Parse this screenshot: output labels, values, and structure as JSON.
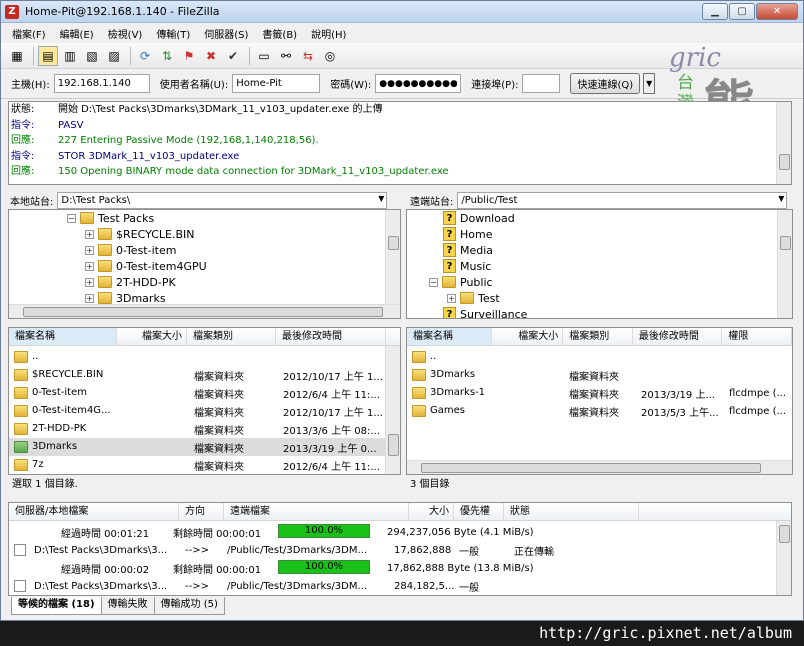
{
  "window": {
    "title": "Home-Pit@192.168.1.140 - FileZilla",
    "app_icon": "Z"
  },
  "menu": [
    "檔案(F)",
    "編輯(E)",
    "檢視(V)",
    "傳輸(T)",
    "伺服器(S)",
    "書籤(B)",
    "說明(H)"
  ],
  "quickconnect": {
    "host_label": "主機(H):",
    "host_value": "192.168.1.140",
    "user_label": "使用者名稱(U):",
    "user_value": "Home-Pit",
    "pass_label": "密碼(W):",
    "pass_value": "●●●●●●●●●●●●",
    "port_label": "連接埠(P):",
    "port_value": "",
    "connect_label": "快速連線(Q)"
  },
  "watermark": {
    "script": "gric",
    "taiwan": "台灣",
    "bear": "熊"
  },
  "log": [
    {
      "key": "狀態:",
      "text": "開始 D:\\Test Packs\\3Dmarks\\3DMark_11_v103_updater.exe 的上傳",
      "color": "#000000"
    },
    {
      "key": "指令:",
      "text": "PASV",
      "color": "#000080"
    },
    {
      "key": "回應:",
      "text": "227 Entering Passive Mode (192,168,1,140,218,56).",
      "color": "#008000"
    },
    {
      "key": "指令:",
      "text": "STOR 3DMark_11_v103_updater.exe",
      "color": "#000080"
    },
    {
      "key": "回應:",
      "text": "150 Opening BINARY mode data connection for 3DMark_11_v103_updater.exe",
      "color": "#008000"
    }
  ],
  "local": {
    "site_label": "本地站台:",
    "path": "D:\\Test Packs\\",
    "tree": [
      {
        "label": "Test Packs",
        "exp": "−",
        "indent": 0
      },
      {
        "label": "$RECYCLE.BIN",
        "exp": "+",
        "indent": 1
      },
      {
        "label": "0-Test-item",
        "exp": "+",
        "indent": 1
      },
      {
        "label": "0-Test-item4GPU",
        "exp": "+",
        "indent": 1
      },
      {
        "label": "2T-HDD-PK",
        "exp": "+",
        "indent": 1
      },
      {
        "label": "3Dmarks",
        "exp": "+",
        "indent": 1
      }
    ],
    "headers": [
      "檔案名稱",
      "檔案大小",
      "檔案類別",
      "最後修改時間"
    ],
    "files": [
      {
        "name": "..",
        "size": "",
        "type": "",
        "modified": ""
      },
      {
        "name": "$RECYCLE.BIN",
        "size": "",
        "type": "檔案資料夾",
        "modified": "2012/10/17 上午 1..."
      },
      {
        "name": "0-Test-item",
        "size": "",
        "type": "檔案資料夾",
        "modified": "2012/6/4 上午 11:..."
      },
      {
        "name": "0-Test-item4G...",
        "size": "",
        "type": "檔案資料夾",
        "modified": "2012/10/17 上午 1..."
      },
      {
        "name": "2T-HDD-PK",
        "size": "",
        "type": "檔案資料夾",
        "modified": "2013/3/6 上午 08:..."
      },
      {
        "name": "3Dmarks",
        "size": "",
        "type": "檔案資料夾",
        "modified": "2013/3/19 上午 0..."
      },
      {
        "name": "7z",
        "size": "",
        "type": "檔案資料夾",
        "modified": "2012/6/4 上午 11:..."
      }
    ],
    "status": "選取 1 個目錄."
  },
  "remote": {
    "site_label": "遠端站台:",
    "path": "/Public/Test",
    "tree": [
      {
        "label": "Download",
        "kind": "q",
        "indent": 0
      },
      {
        "label": "Home",
        "kind": "q",
        "indent": 0
      },
      {
        "label": "Media",
        "kind": "q",
        "indent": 0
      },
      {
        "label": "Music",
        "kind": "q",
        "indent": 0
      },
      {
        "label": "Public",
        "kind": "folder",
        "exp": "−",
        "indent": 0
      },
      {
        "label": "Test",
        "kind": "folder",
        "exp": "+",
        "indent": 1
      },
      {
        "label": "Surveillance",
        "kind": "q",
        "indent": 0
      }
    ],
    "headers": [
      "檔案名稱",
      "檔案大小",
      "檔案類別",
      "最後修改時間",
      "權限"
    ],
    "files": [
      {
        "name": "..",
        "size": "",
        "type": "",
        "modified": "",
        "perm": ""
      },
      {
        "name": "3Dmarks",
        "size": "",
        "type": "檔案資料夾",
        "modified": "",
        "perm": ""
      },
      {
        "name": "3Dmarks-1",
        "size": "",
        "type": "檔案資料夾",
        "modified": "2013/3/19 上...",
        "perm": "flcdmpe (..."
      },
      {
        "name": "Games",
        "size": "",
        "type": "檔案資料夾",
        "modified": "2013/5/3 上午...",
        "perm": "flcdmpe (..."
      }
    ],
    "status": "3 個目錄"
  },
  "queue": {
    "headers": [
      "伺服器/本地檔案",
      "方向",
      "遠端檔案",
      "大小",
      "優先權",
      "狀態"
    ],
    "rows": [
      {
        "kind": "progress",
        "elapsed": "經過時間 00:01:21",
        "remaining": "剩餘時間 00:00:01",
        "percent": "100.0%",
        "fill": 1.0,
        "bytes": "294,237,056 Byte (4.1 MiB/s)"
      },
      {
        "kind": "file",
        "local": "D:\\Test Packs\\3Dmarks\\3...",
        "dir": "-->>",
        "remote": "/Public/Test/3Dmarks/3DM...",
        "size": "17,862,888",
        "priority": "一般",
        "status": "正在傳輸"
      },
      {
        "kind": "progress",
        "elapsed": "經過時間 00:00:02",
        "remaining": "剩餘時間 00:00:01",
        "percent": "100.0%",
        "fill": 1.0,
        "bytes": "17,862,888 Byte (13.8 MiB/s)"
      },
      {
        "kind": "file",
        "local": "D:\\Test Packs\\3Dmarks\\3...",
        "dir": "-->>",
        "remote": "/Public/Test/3Dmarks/3DM...",
        "size": "284,182,5...",
        "priority": "一般",
        "status": ""
      }
    ],
    "tabs": [
      "等候的檔案 (18)",
      "傳輸失敗",
      "傳輸成功 (5)"
    ]
  },
  "footer": "http://gric.pixnet.net/album"
}
